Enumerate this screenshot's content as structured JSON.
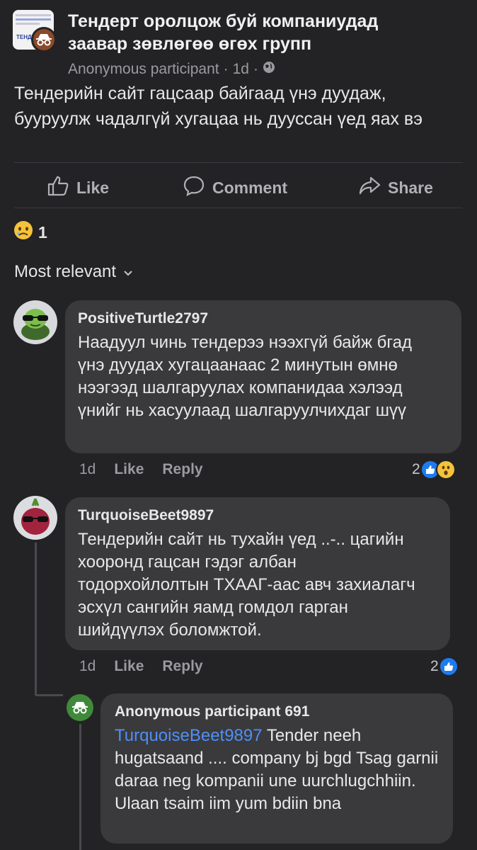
{
  "group": {
    "title": "Тендерт оролцож буй компаниудад заавар зөвлөгөө өгөх групп",
    "thumb_text": "ТЕНДЕР"
  },
  "post": {
    "author": "Anonymous participant",
    "time": "1d",
    "separator": "·",
    "body": "Тендерийн сайт гацсаар байгаад үнэ дуудаж, бууруулж чадалгүй хугацаа нь дууссан үед яах вэ",
    "reaction_count": "1"
  },
  "actions": {
    "like": "Like",
    "comment": "Comment",
    "share": "Share"
  },
  "sort_label": "Most relevant",
  "comments": [
    {
      "author": "PositiveTurtle2797",
      "text": "Наадуул чинь тендерээ нээхгүй байж бгад үнэ дуудах хугацаанаас 2 минутын өмнө нээгээд шалгаруулах компанидаа хэлээд үнийг нь хасуулаад шалгаруулчихдаг шүү",
      "time": "1d",
      "like": "Like",
      "reply": "Reply",
      "reaction_count": "2"
    },
    {
      "author": "TurquoiseBeet9897",
      "text": "Тендерийн сайт нь тухайн үед ..-.. цагийн хооронд гацсан гэдэг албан тодорхойлолтын ТХААГ-аас авч захиалагч эсхүл сангийн яамд гомдол гарган шийдүүлэх боломжтой.",
      "time": "1d",
      "like": "Like",
      "reply": "Reply",
      "reaction_count": "2"
    }
  ],
  "reply": {
    "author": "Anonymous participant 691",
    "mention": "TurquoiseBeet9897",
    "text": " Tender neeh hugatsaand .... company bj bgd Tsag garnii daraa neg kompanii une uurchlugchhiin. Ulaan tsaim iim yum bdiin bna"
  },
  "colors": {
    "background": "#232325",
    "bubble": "#3a3a3c",
    "like_blue": "#1d7bf0",
    "mention_blue": "#4f8ff7",
    "anon_badge": "#8a4a2a",
    "reply_anon_badge": "#3f8a3a"
  },
  "icons": [
    "incognito-icon",
    "globe-icon",
    "like-icon",
    "comment-icon",
    "share-icon",
    "sad-face-icon",
    "chevron-down-icon",
    "wow-face-icon",
    "turtle-avatar",
    "beet-avatar"
  ]
}
